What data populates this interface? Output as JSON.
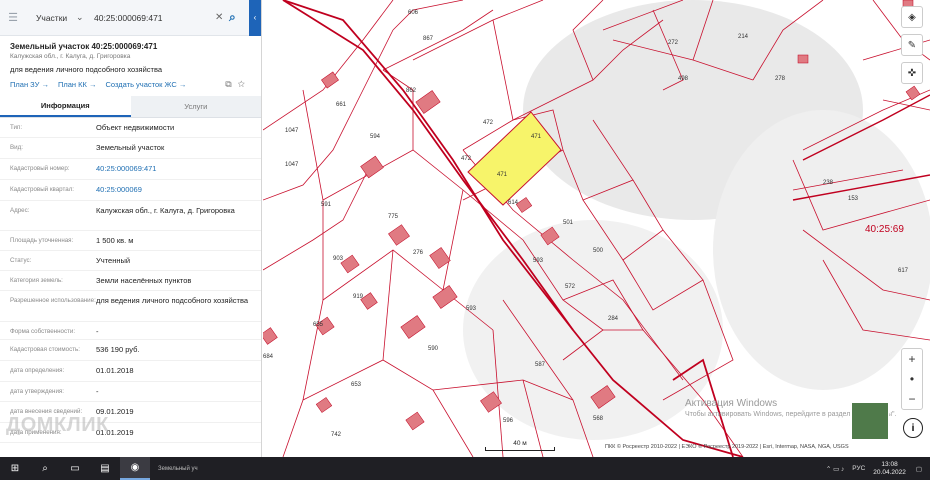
{
  "search": {
    "type_label": "Участки",
    "query": "40:25:000069:471"
  },
  "parcel": {
    "title": "Земельный участок 40:25:000069:471",
    "address_short": "Калужская обл., г. Калуга, д. Григоровка",
    "purpose": "для ведения личного подсобного хозяйства",
    "links": [
      "План ЗУ →",
      "План КК →",
      "Создать участок ЖС →"
    ]
  },
  "tabs": [
    {
      "label": "Информация",
      "active": true
    },
    {
      "label": "Услуги",
      "active": false
    }
  ],
  "info_rows": [
    {
      "key": "Тип:",
      "value": "Объект недвижимости",
      "link": false
    },
    {
      "key": "Вид:",
      "value": "Земельный участок",
      "link": false
    },
    {
      "key": "Кадастровый номер:",
      "value": "40:25:000069:471",
      "link": true
    },
    {
      "key": "Кадастровый квартал:",
      "value": "40:25:000069",
      "link": true
    },
    {
      "key": "Адрес:",
      "value": "Калужская обл., г. Калуга, д. Григоровка",
      "link": false
    },
    {
      "key": "Площадь уточненная:",
      "value": "1 500 кв. м",
      "link": false
    },
    {
      "key": "Статус:",
      "value": "Учтенный",
      "link": false
    },
    {
      "key": "Категория земель:",
      "value": "Земли населённых пунктов",
      "link": false
    },
    {
      "key": "Разрешенное использование:",
      "value": "для ведения личного подсобного хозяйства",
      "link": false
    },
    {
      "key": "Форма собственности:",
      "value": "-",
      "link": false
    },
    {
      "key": "Кадастровая стоимость:",
      "value": "536 190 руб.",
      "link": false
    },
    {
      "key": "дата определения:",
      "value": "01.01.2018",
      "link": false
    },
    {
      "key": "дата утверждения:",
      "value": "-",
      "link": false
    },
    {
      "key": "дата внесения сведений:",
      "value": "09.01.2019",
      "link": false
    },
    {
      "key": "дата применения:",
      "value": "01.01.2019",
      "link": false
    }
  ],
  "map": {
    "quarter_label": "40:25:69",
    "scale_label": "40 м",
    "attribution": "ПКК © Росреестр 2010-2022 | ЕЭКО © Росреестр 2019-2022 | Esri, Intermap, NASA, NGA, USGS",
    "activation_title": "Активация Windows",
    "activation_text": "Чтобы активировать Windows, перейдите в раздел \"Параметры\".",
    "parcel_labels": [
      "606",
      "867",
      "272",
      "214",
      "278",
      "498",
      "862",
      "661",
      "472",
      "471",
      "1047",
      "594",
      "472",
      "471",
      "1047",
      "591",
      "775",
      "614",
      "501",
      "238",
      "153",
      "500",
      "276",
      "903",
      "593",
      "572",
      "617",
      "919",
      "593",
      "284",
      "655",
      "684",
      "590",
      "587",
      "653",
      "596",
      "568",
      "742"
    ],
    "selected_color": "#f7f46a",
    "boundary_color": "#c0001f",
    "building_color": "#e07a82"
  },
  "watermark": "ДОМКЛИК",
  "taskbar": {
    "app_label": "Земельный уч",
    "lang": "РУС",
    "time": "13:08",
    "date": "20.04.2022"
  }
}
